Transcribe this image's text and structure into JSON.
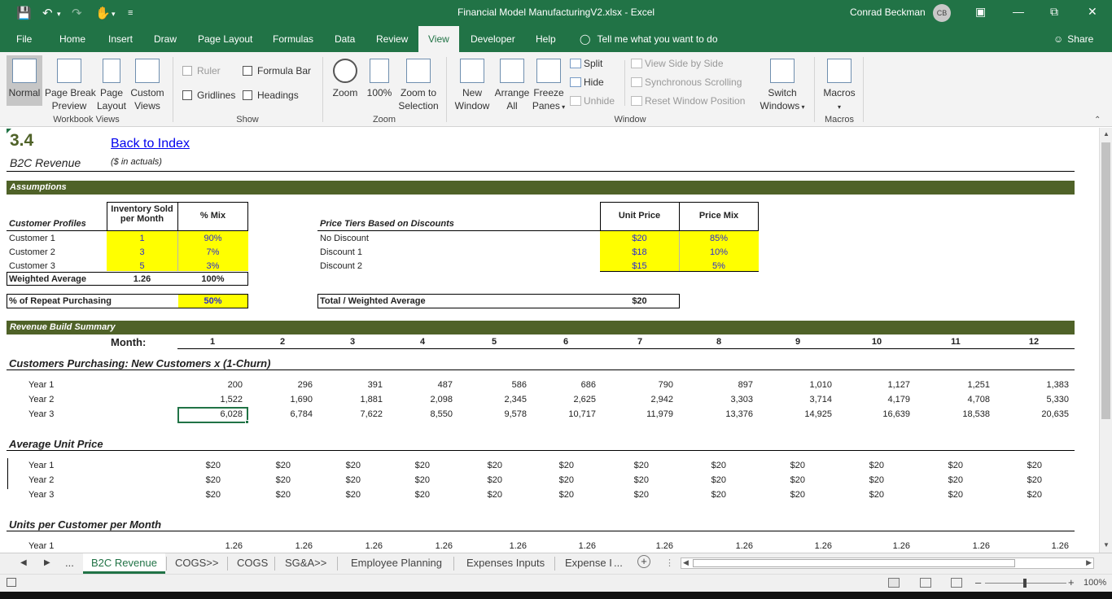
{
  "window": {
    "title": "Financial Model ManufacturingV2.xlsx  -  Excel",
    "user_name": "Conrad Beckman",
    "user_initials": "CB"
  },
  "ribbon_tabs": [
    "File",
    "Home",
    "Insert",
    "Draw",
    "Page Layout",
    "Formulas",
    "Data",
    "Review",
    "View",
    "Developer",
    "Help"
  ],
  "tell_me": "Tell me what you want to do",
  "share": "Share",
  "ribbon": {
    "workbook_views": {
      "normal": "Normal",
      "page_break_1": "Page Break",
      "page_break_2": "Preview",
      "page_layout_1": "Page",
      "page_layout_2": "Layout",
      "custom_views_1": "Custom",
      "custom_views_2": "Views",
      "group": "Workbook Views"
    },
    "show": {
      "ruler": "Ruler",
      "gridlines": "Gridlines",
      "formula_bar": "Formula Bar",
      "headings": "Headings",
      "group": "Show"
    },
    "zoom": {
      "zoom": "Zoom",
      "hundred": "100%",
      "zoom_to_1": "Zoom to",
      "zoom_to_2": "Selection",
      "group": "Zoom"
    },
    "window": {
      "new_1": "New",
      "new_2": "Window",
      "arrange_1": "Arrange",
      "arrange_2": "All",
      "freeze_1": "Freeze",
      "freeze_2": "Panes",
      "split": "Split",
      "hide": "Hide",
      "unhide": "Unhide",
      "side_by_side": "View Side by Side",
      "sync": "Synchronous Scrolling",
      "reset": "Reset Window Position",
      "switch_1": "Switch",
      "switch_2": "Windows",
      "group": "Window"
    },
    "macros": {
      "macros": "Macros",
      "group": "Macros"
    }
  },
  "sheet": {
    "section_number": "3.4",
    "back_link": "Back to Index",
    "page_title": "B2C Revenue",
    "units_note": "($ in actuals)",
    "assumptions_title": "Assumptions",
    "customer_profiles": {
      "label": "Customer Profiles",
      "col_inventory_1": "Inventory Sold",
      "col_inventory_2": "per Month",
      "col_mix": "% Mix",
      "rows": [
        {
          "name": "Customer 1",
          "inv": "1",
          "mix": "90%"
        },
        {
          "name": "Customer 2",
          "inv": "3",
          "mix": "7%"
        },
        {
          "name": "Customer 3",
          "inv": "5",
          "mix": "3%"
        }
      ],
      "weighted_label": "Weighted Average",
      "weighted_inv": "1.26",
      "weighted_mix": "100%",
      "repeat_label": "% of Repeat Purchasing",
      "repeat_value": "50%"
    },
    "price_tiers": {
      "label": "Price Tiers Based on Discounts",
      "col_price": "Unit Price",
      "col_mix": "Price Mix",
      "rows": [
        {
          "name": "No Discount",
          "price": "$20",
          "mix": "85%"
        },
        {
          "name": "Discount 1",
          "price": "$18",
          "mix": "10%"
        },
        {
          "name": "Discount 2",
          "price": "$15",
          "mix": "5%"
        }
      ],
      "total_label": "Total / Weighted Average",
      "total_value": "$20"
    },
    "revenue_title": "Revenue Build Summary",
    "month_label": "Month:",
    "months": [
      "1",
      "2",
      "3",
      "4",
      "5",
      "6",
      "7",
      "8",
      "9",
      "10",
      "11",
      "12"
    ],
    "sections": [
      {
        "title": "Customers Purchasing: New Customers x (1-Churn)",
        "rows": [
          {
            "label": "Year 1",
            "values": [
              "200",
              "296",
              "391",
              "487",
              "586",
              "686",
              "790",
              "897",
              "1,010",
              "1,127",
              "1,251",
              "1,383"
            ]
          },
          {
            "label": "Year 2",
            "values": [
              "1,522",
              "1,690",
              "1,881",
              "2,098",
              "2,345",
              "2,625",
              "2,942",
              "3,303",
              "3,714",
              "4,179",
              "4,708",
              "5,330"
            ]
          },
          {
            "label": "Year 3",
            "values": [
              "6,028",
              "6,784",
              "7,622",
              "8,550",
              "9,578",
              "10,717",
              "11,979",
              "13,376",
              "14,925",
              "16,639",
              "18,538",
              "20,635"
            ]
          }
        ]
      },
      {
        "title": "Average Unit Price",
        "rows": [
          {
            "label": "Year 1",
            "values": [
              "$20",
              "$20",
              "$20",
              "$20",
              "$20",
              "$20",
              "$20",
              "$20",
              "$20",
              "$20",
              "$20",
              "$20"
            ]
          },
          {
            "label": "Year 2",
            "values": [
              "$20",
              "$20",
              "$20",
              "$20",
              "$20",
              "$20",
              "$20",
              "$20",
              "$20",
              "$20",
              "$20",
              "$20"
            ]
          },
          {
            "label": "Year 3",
            "values": [
              "$20",
              "$20",
              "$20",
              "$20",
              "$20",
              "$20",
              "$20",
              "$20",
              "$20",
              "$20",
              "$20",
              "$20"
            ]
          }
        ]
      },
      {
        "title": "Units per Customer per Month",
        "rows": [
          {
            "label": "Year 1",
            "values": [
              "1.26",
              "1.26",
              "1.26",
              "1.26",
              "1.26",
              "1.26",
              "1.26",
              "1.26",
              "1.26",
              "1.26",
              "1.26",
              "1.26"
            ]
          }
        ]
      }
    ]
  },
  "sheet_tabs": {
    "ellipsis_left": "...",
    "tabs": [
      "B2C Revenue",
      "COGS>>",
      "COGS",
      "SG&A>>",
      "Employee Planning",
      "Expenses Inputs",
      "Expense I"
    ],
    "ellipsis_right": "...",
    "add": "+"
  },
  "status": {
    "zoom": "100%"
  },
  "colors": {
    "excel_green": "#217346",
    "header_olive": "#4f6228",
    "input_yellow": "#ffff00"
  }
}
